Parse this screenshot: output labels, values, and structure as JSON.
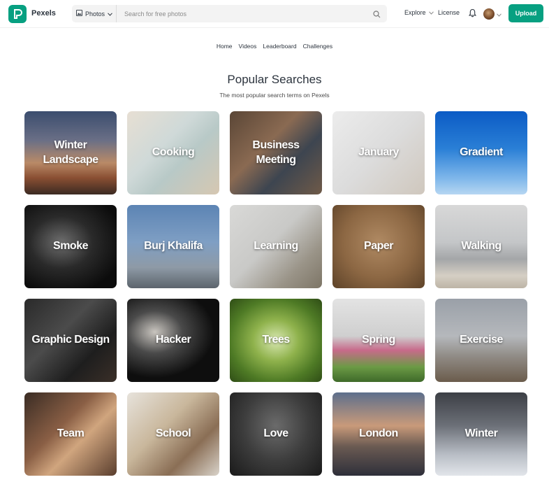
{
  "header": {
    "brand": "Pexels",
    "search_type": "Photos",
    "search_placeholder": "Search for free photos",
    "explore": "Explore",
    "license": "License",
    "upload": "Upload"
  },
  "subnav": [
    "Home",
    "Videos",
    "Leaderboard",
    "Challenges"
  ],
  "section": {
    "title": "Popular Searches",
    "subtitle": "The most popular search terms on Pexels"
  },
  "tiles": [
    {
      "label": "Winter\nLandscape",
      "bg": "linear-gradient(180deg,#3b4d6e 0%,#6a6f86 35%,#b98a67 62%,#8a4f33 80%,#3b2a22 100%)"
    },
    {
      "label": "Cooking",
      "bg": "linear-gradient(135deg,#e7dfd3 0%,#cfd9d8 40%,#b8c9c7 60%,#d6c7b1 100%)"
    },
    {
      "label": "Business\nMeeting",
      "bg": "linear-gradient(135deg,#5a4636 0%,#8a6a52 40%,#3d4550 65%,#6f5a48 100%)"
    },
    {
      "label": "January",
      "bg": "linear-gradient(135deg,#ececec 0%,#dcdcdc 50%,#cfc7bd 100%)"
    },
    {
      "label": "Gradient",
      "bg": "linear-gradient(180deg,#0b5bc5 0%,#2a7fd6 45%,#7db6ea 80%,#b6d6f2 100%)"
    },
    {
      "label": "Smoke",
      "bg": "radial-gradient(ellipse at 40% 45%,#6e6e6e 0%,#2a2a2a 40%,#0c0c0c 80%)"
    },
    {
      "label": "Burj Khalifa",
      "bg": "linear-gradient(180deg,#5c84b4 0%,#7f9fc4 45%,#8e9aa6 75%,#5c646c 100%)"
    },
    {
      "label": "Learning",
      "bg": "linear-gradient(135deg,#d9d9d7 0%,#c9c9c7 45%,#9a9488 75%,#7d7566 100%)"
    },
    {
      "label": "Paper",
      "bg": "radial-gradient(ellipse at 50% 45%,#b08a63 0%,#8c6743 55%,#5e4329 100%)"
    },
    {
      "label": "Walking",
      "bg": "linear-gradient(180deg,#d8d8d8 0%,#c4c6c8 45%,#a4a6a8 65%,#d5cfc4 85%,#bdb4a6 100%)"
    },
    {
      "label": "Graphic Design",
      "bg": "linear-gradient(135deg,#2a2a2a 0%,#4b4b4b 40%,#1e1e1e 70%,#3a2f28 100%)"
    },
    {
      "label": "Hacker",
      "bg": "radial-gradient(ellipse at 30% 40%,#c9c5bf 0%,#4a4a4a 30%,#0e0e0e 65%)"
    },
    {
      "label": "Trees",
      "bg": "radial-gradient(ellipse at 50% 50%,#d9e8b2 0%,#8fb24c 35%,#4e7a25 70%,#2f4d16 100%)"
    },
    {
      "label": "Spring",
      "bg": "linear-gradient(180deg,#e3e3e3 0%,#cfcfcf 45%,#c76a8a 62%,#6b9a45 82%,#3f6a2a 100%)"
    },
    {
      "label": "Exercise",
      "bg": "linear-gradient(180deg,#9aa0a8 0%,#b5b8bc 45%,#8f8a84 70%,#6b5c4c 100%)"
    },
    {
      "label": "Team",
      "bg": "linear-gradient(135deg,#3a2c24 0%,#8a5f45 40%,#d0a57e 60%,#5a3e2e 100%)"
    },
    {
      "label": "School",
      "bg": "linear-gradient(135deg,#e7e3dc 0%,#c9b79c 40%,#8a6e55 70%,#d9d3ca 100%)"
    },
    {
      "label": "Love",
      "bg": "radial-gradient(ellipse at 50% 40%,#6b6b6b 0%,#3d3d3d 50%,#1a1a1a 100%)"
    },
    {
      "label": "London",
      "bg": "linear-gradient(180deg,#5d6f8c 0%,#c99a7a 40%,#6a5a52 65%,#2e2f3a 100%)"
    },
    {
      "label": "Winter",
      "bg": "linear-gradient(180deg,#3c3f45 0%,#6c7078 40%,#b9bec6 75%,#e2e5ea 100%)"
    }
  ]
}
